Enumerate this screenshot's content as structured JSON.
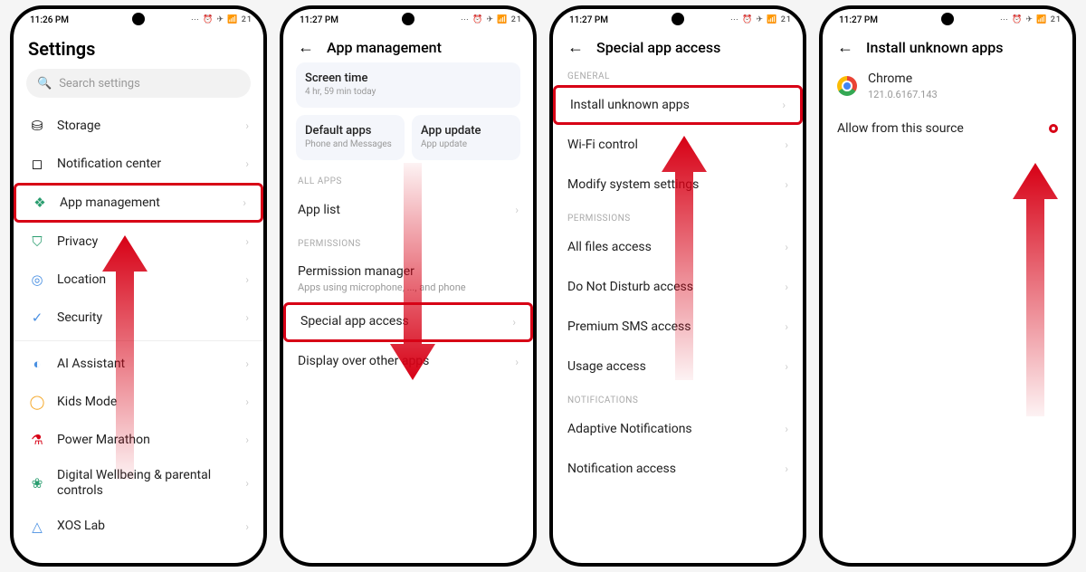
{
  "status": {
    "time1": "11:26 PM",
    "time2": "11:27 PM",
    "icons": "⋯ ⏰ ✈ 📶 21"
  },
  "screen1": {
    "title": "Settings",
    "search_placeholder": "Search settings",
    "items": [
      {
        "icon": "⛁",
        "label": "Storage"
      },
      {
        "icon": "◻",
        "label": "Notification center"
      },
      {
        "icon": "❖",
        "label": "App management"
      },
      {
        "icon": "⛉",
        "label": "Privacy"
      },
      {
        "icon": "◎",
        "label": "Location"
      },
      {
        "icon": "✓",
        "label": "Security"
      },
      {
        "icon": "◐",
        "label": "AI Assistant"
      },
      {
        "icon": "◯",
        "label": "Kids Mode"
      },
      {
        "icon": "⚗",
        "label": "Power Marathon"
      },
      {
        "icon": "❀",
        "label": "Digital Wellbeing & parental controls"
      },
      {
        "icon": "△",
        "label": "XOS Lab"
      }
    ]
  },
  "screen2": {
    "title": "App management",
    "cards": {
      "screen_time": {
        "title": "Screen time",
        "sub": "4 hr, 59 min today"
      },
      "default_apps": {
        "title": "Default apps",
        "sub": "Phone and Messages"
      },
      "app_update": {
        "title": "App update",
        "sub": "App update"
      }
    },
    "section_allapps": "ALL APPS",
    "app_list": "App list",
    "section_perm": "PERMISSIONS",
    "perm_mgr": {
      "title": "Permission manager",
      "sub": "Apps using microphone, ..., and phone"
    },
    "special_access": "Special app access",
    "display_over": "Display over other apps"
  },
  "screen3": {
    "title": "Special app access",
    "section_general": "GENERAL",
    "items_general": [
      "Install unknown apps",
      "Wi-Fi control",
      "Modify system settings"
    ],
    "section_perm": "PERMISSIONS",
    "items_perm": [
      "All files access",
      "Do Not Disturb access",
      "Premium SMS access",
      "Usage access"
    ],
    "section_notif": "NOTIFICATIONS",
    "items_notif": [
      "Adaptive Notifications",
      "Notification access"
    ]
  },
  "screen4": {
    "title": "Install unknown apps",
    "app_name": "Chrome",
    "app_version": "121.0.6167.143",
    "allow_label": "Allow from this source"
  }
}
